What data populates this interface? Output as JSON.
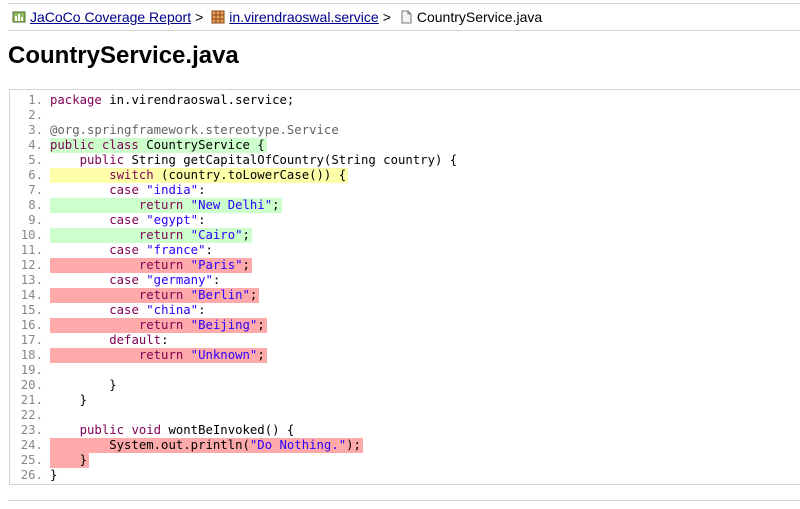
{
  "breadcrumb": {
    "report": "JaCoCo Coverage Report",
    "separator": ">",
    "package": "in.virendraoswal.service",
    "file": "CountryService.java"
  },
  "page_title": "CountryService.java",
  "colors": {
    "covered": "#ccffcc",
    "not_covered": "#ffaaaa",
    "partial": "#ffffaa",
    "keyword": "#7f0055",
    "string": "#2a00ff",
    "link": "#00008b"
  },
  "source_lines": [
    {
      "num": "1.",
      "cov": "",
      "tokens": [
        {
          "t": "package",
          "c": "kw"
        },
        {
          "t": " in.virendraoswal.service;",
          "c": "plain"
        }
      ]
    },
    {
      "num": "2.",
      "cov": "",
      "tokens": []
    },
    {
      "num": "3.",
      "cov": "",
      "tokens": [
        {
          "t": "@org.springframework.stereotype.Service",
          "c": "ann"
        }
      ]
    },
    {
      "num": "4.",
      "cov": "fc",
      "tokens": [
        {
          "t": "public class",
          "c": "kw"
        },
        {
          "t": " CountryService {",
          "c": "plain"
        }
      ]
    },
    {
      "num": "5.",
      "cov": "",
      "tokens": [
        {
          "t": "    ",
          "c": "plain"
        },
        {
          "t": "public",
          "c": "kw"
        },
        {
          "t": " String getCapitalOfCountry(String country) {",
          "c": "plain"
        }
      ]
    },
    {
      "num": "6.",
      "cov": "pc",
      "branch": true,
      "tokens": [
        {
          "t": "        ",
          "c": "plain"
        },
        {
          "t": "switch",
          "c": "kw"
        },
        {
          "t": " (country.toLowerCase()) {",
          "c": "plain"
        }
      ]
    },
    {
      "num": "7.",
      "cov": "",
      "tokens": [
        {
          "t": "        ",
          "c": "plain"
        },
        {
          "t": "case",
          "c": "kw"
        },
        {
          "t": " ",
          "c": "plain"
        },
        {
          "t": "\"india\"",
          "c": "str"
        },
        {
          "t": ":",
          "c": "plain"
        }
      ]
    },
    {
      "num": "8.",
      "cov": "fc",
      "tokens": [
        {
          "t": "            ",
          "c": "plain"
        },
        {
          "t": "return",
          "c": "kw"
        },
        {
          "t": " ",
          "c": "plain"
        },
        {
          "t": "\"New Delhi\"",
          "c": "str"
        },
        {
          "t": ";",
          "c": "plain"
        }
      ]
    },
    {
      "num": "9.",
      "cov": "",
      "tokens": [
        {
          "t": "        ",
          "c": "plain"
        },
        {
          "t": "case",
          "c": "kw"
        },
        {
          "t": " ",
          "c": "plain"
        },
        {
          "t": "\"egypt\"",
          "c": "str"
        },
        {
          "t": ":",
          "c": "plain"
        }
      ]
    },
    {
      "num": "10.",
      "cov": "fc",
      "tokens": [
        {
          "t": "            ",
          "c": "plain"
        },
        {
          "t": "return",
          "c": "kw"
        },
        {
          "t": " ",
          "c": "plain"
        },
        {
          "t": "\"Cairo\"",
          "c": "str"
        },
        {
          "t": ";",
          "c": "plain"
        }
      ]
    },
    {
      "num": "11.",
      "cov": "",
      "tokens": [
        {
          "t": "        ",
          "c": "plain"
        },
        {
          "t": "case",
          "c": "kw"
        },
        {
          "t": " ",
          "c": "plain"
        },
        {
          "t": "\"france\"",
          "c": "str"
        },
        {
          "t": ":",
          "c": "plain"
        }
      ]
    },
    {
      "num": "12.",
      "cov": "nc",
      "tokens": [
        {
          "t": "            ",
          "c": "plain"
        },
        {
          "t": "return",
          "c": "kw"
        },
        {
          "t": " ",
          "c": "plain"
        },
        {
          "t": "\"Paris\"",
          "c": "str"
        },
        {
          "t": ";",
          "c": "plain"
        }
      ]
    },
    {
      "num": "13.",
      "cov": "",
      "tokens": [
        {
          "t": "        ",
          "c": "plain"
        },
        {
          "t": "case",
          "c": "kw"
        },
        {
          "t": " ",
          "c": "plain"
        },
        {
          "t": "\"germany\"",
          "c": "str"
        },
        {
          "t": ":",
          "c": "plain"
        }
      ]
    },
    {
      "num": "14.",
      "cov": "nc",
      "tokens": [
        {
          "t": "            ",
          "c": "plain"
        },
        {
          "t": "return",
          "c": "kw"
        },
        {
          "t": " ",
          "c": "plain"
        },
        {
          "t": "\"Berlin\"",
          "c": "str"
        },
        {
          "t": ";",
          "c": "plain"
        }
      ]
    },
    {
      "num": "15.",
      "cov": "",
      "tokens": [
        {
          "t": "        ",
          "c": "plain"
        },
        {
          "t": "case",
          "c": "kw"
        },
        {
          "t": " ",
          "c": "plain"
        },
        {
          "t": "\"china\"",
          "c": "str"
        },
        {
          "t": ":",
          "c": "plain"
        }
      ]
    },
    {
      "num": "16.",
      "cov": "nc",
      "tokens": [
        {
          "t": "            ",
          "c": "plain"
        },
        {
          "t": "return",
          "c": "kw"
        },
        {
          "t": " ",
          "c": "plain"
        },
        {
          "t": "\"Beijing\"",
          "c": "str"
        },
        {
          "t": ";",
          "c": "plain"
        }
      ]
    },
    {
      "num": "17.",
      "cov": "",
      "tokens": [
        {
          "t": "        ",
          "c": "plain"
        },
        {
          "t": "default",
          "c": "kw"
        },
        {
          "t": ":",
          "c": "plain"
        }
      ]
    },
    {
      "num": "18.",
      "cov": "nc",
      "tokens": [
        {
          "t": "            ",
          "c": "plain"
        },
        {
          "t": "return",
          "c": "kw"
        },
        {
          "t": " ",
          "c": "plain"
        },
        {
          "t": "\"Unknown\"",
          "c": "str"
        },
        {
          "t": ";",
          "c": "plain"
        }
      ]
    },
    {
      "num": "19.",
      "cov": "",
      "tokens": []
    },
    {
      "num": "20.",
      "cov": "",
      "tokens": [
        {
          "t": "        }",
          "c": "plain"
        }
      ]
    },
    {
      "num": "21.",
      "cov": "",
      "tokens": [
        {
          "t": "    }",
          "c": "plain"
        }
      ]
    },
    {
      "num": "22.",
      "cov": "",
      "tokens": []
    },
    {
      "num": "23.",
      "cov": "",
      "tokens": [
        {
          "t": "    ",
          "c": "plain"
        },
        {
          "t": "public void",
          "c": "kw"
        },
        {
          "t": " wontBeInvoked() {",
          "c": "plain"
        }
      ]
    },
    {
      "num": "24.",
      "cov": "nc",
      "tokens": [
        {
          "t": "        System.out.println(",
          "c": "plain"
        },
        {
          "t": "\"Do Nothing.\"",
          "c": "str"
        },
        {
          "t": ");",
          "c": "plain"
        }
      ]
    },
    {
      "num": "25.",
      "cov": "nc",
      "tokens": [
        {
          "t": "    }",
          "c": "plain"
        }
      ]
    },
    {
      "num": "26.",
      "cov": "",
      "tokens": [
        {
          "t": "}",
          "c": "plain"
        }
      ]
    }
  ]
}
